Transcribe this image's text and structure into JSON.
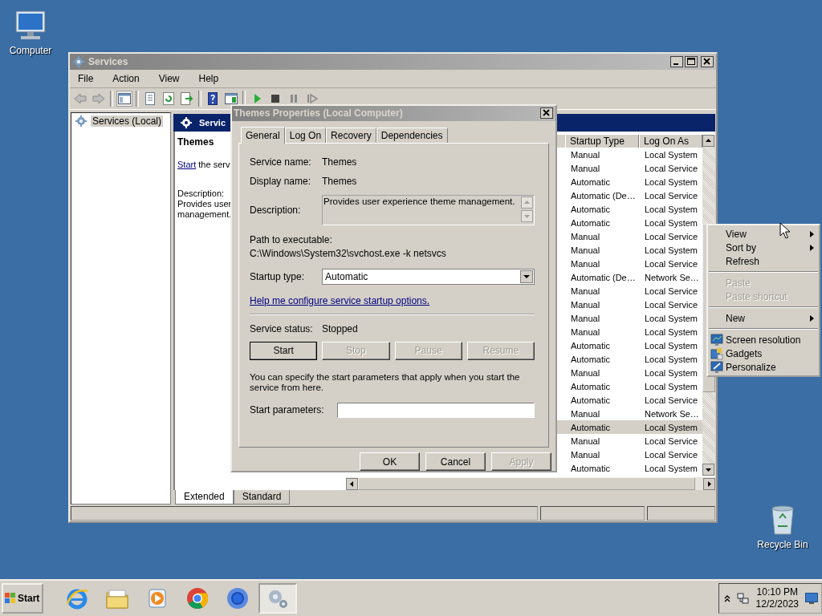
{
  "desktop_icons": [
    {
      "kind": "computer",
      "label": "Computer"
    },
    {
      "kind": "recycle_bin",
      "label": "Recycle Bin"
    }
  ],
  "services_window": {
    "title": "Services",
    "menu": [
      "File",
      "Action",
      "View",
      "Help"
    ],
    "tree": [
      {
        "label": "Services (Local)",
        "selected": true
      }
    ],
    "header": "Servic",
    "extended": {
      "name": "Themes",
      "start_link": "Start",
      "start_text": "the serv",
      "description_label": "Description:",
      "description_lines": [
        "Provides user",
        "management."
      ]
    },
    "columns": [
      "Startup Type",
      "Log On As"
    ],
    "rows": [
      {
        "startup_type": "Manual",
        "log_on_as": "Local System",
        "selected": false
      },
      {
        "startup_type": "Manual",
        "log_on_as": "Local Service",
        "selected": false
      },
      {
        "startup_type": "Automatic",
        "log_on_as": "Local System",
        "selected": false
      },
      {
        "startup_type": "Automatic (De…",
        "log_on_as": "Local Service",
        "selected": false
      },
      {
        "startup_type": "Automatic",
        "log_on_as": "Local System",
        "selected": false
      },
      {
        "startup_type": "Automatic",
        "log_on_as": "Local System",
        "selected": false
      },
      {
        "startup_type": "Manual",
        "log_on_as": "Local Service",
        "selected": false
      },
      {
        "startup_type": "Manual",
        "log_on_as": "Local System",
        "selected": false
      },
      {
        "startup_type": "Manual",
        "log_on_as": "Local Service",
        "selected": false
      },
      {
        "startup_type": "Automatic (De…",
        "log_on_as": "Network Se…",
        "selected": false
      },
      {
        "startup_type": "Manual",
        "log_on_as": "Local Service",
        "selected": false
      },
      {
        "startup_type": "Manual",
        "log_on_as": "Local Service",
        "selected": false
      },
      {
        "startup_type": "Manual",
        "log_on_as": "Local System",
        "selected": false
      },
      {
        "startup_type": "Manual",
        "log_on_as": "Local System",
        "selected": false
      },
      {
        "startup_type": "Automatic",
        "log_on_as": "Local System",
        "selected": false
      },
      {
        "startup_type": "Automatic",
        "log_on_as": "Local System",
        "selected": false
      },
      {
        "startup_type": "Manual",
        "log_on_as": "Local System",
        "selected": false
      },
      {
        "startup_type": "Automatic",
        "log_on_as": "Local System",
        "selected": false
      },
      {
        "startup_type": "Automatic",
        "log_on_as": "Local Service",
        "selected": false
      },
      {
        "startup_type": "Manual",
        "log_on_as": "Network Se…",
        "selected": false
      },
      {
        "startup_type": "Automatic",
        "log_on_as": "Local System",
        "selected": true
      },
      {
        "startup_type": "Manual",
        "log_on_as": "Local Service",
        "selected": false
      },
      {
        "startup_type": "Manual",
        "log_on_as": "Local Service",
        "selected": false
      },
      {
        "startup_type": "Automatic",
        "log_on_as": "Local System",
        "selected": false
      }
    ],
    "view_tabs": [
      {
        "label": "Extended",
        "selected": true
      },
      {
        "label": "Standard",
        "selected": false
      }
    ]
  },
  "dialog": {
    "title": "Themes Properties (Local Computer)",
    "tabs": [
      {
        "label": "General",
        "selected": true
      },
      {
        "label": "Log On",
        "selected": false
      },
      {
        "label": "Recovery",
        "selected": false
      },
      {
        "label": "Dependencies",
        "selected": false
      }
    ],
    "service_name": {
      "label": "Service name:",
      "value": "Themes"
    },
    "display_name": {
      "label": "Display name:",
      "value": "Themes"
    },
    "description": {
      "label": "Description:",
      "value": "Provides user experience theme management."
    },
    "path": {
      "label": "Path to executable:",
      "value": "C:\\Windows\\System32\\svchost.exe -k netsvcs"
    },
    "startup_type": {
      "label": "Startup type:",
      "value": "Automatic"
    },
    "help_link": "Help me configure service startup options.",
    "service_status": {
      "label": "Service status:",
      "value": "Stopped"
    },
    "control_buttons": [
      {
        "label": "Start",
        "disabled": false
      },
      {
        "label": "Stop",
        "disabled": true
      },
      {
        "label": "Pause",
        "disabled": true
      },
      {
        "label": "Resume",
        "disabled": true
      }
    ],
    "note": "You can specify the start parameters that apply when you start the service from here.",
    "start_parameters": {
      "label": "Start parameters:"
    },
    "buttons": [
      {
        "label": "OK",
        "disabled": false
      },
      {
        "label": "Cancel",
        "disabled": false
      },
      {
        "label": "Apply",
        "disabled": true
      }
    ]
  },
  "context_menu": [
    {
      "kind": "submenu",
      "label": "View",
      "disabled": false
    },
    {
      "kind": "submenu",
      "label": "Sort by",
      "disabled": false
    },
    {
      "kind": "plain",
      "label": "Refresh",
      "disabled": false
    },
    {
      "kind": "separator"
    },
    {
      "kind": "plain",
      "label": "Paste",
      "disabled": true
    },
    {
      "kind": "plain",
      "label": "Paste shortcut",
      "disabled": true
    },
    {
      "kind": "separator"
    },
    {
      "kind": "submenu",
      "label": "New",
      "disabled": false
    },
    {
      "kind": "separator"
    },
    {
      "kind": "monitor",
      "label": "Screen resolution",
      "disabled": false
    },
    {
      "kind": "gadgets",
      "label": "Gadgets",
      "disabled": false
    },
    {
      "kind": "brush",
      "label": "Personalize",
      "disabled": false
    }
  ],
  "taskbar": {
    "start": "Start",
    "apps": [
      {
        "kind": "ie",
        "selected": false
      },
      {
        "kind": "folder",
        "selected": false
      },
      {
        "kind": "media",
        "selected": false
      },
      {
        "kind": "chrome",
        "selected": false
      },
      {
        "kind": "ring",
        "selected": false
      },
      {
        "kind": "services",
        "selected": true
      }
    ],
    "time": "10:10 PM",
    "date": "12/2/2023"
  }
}
